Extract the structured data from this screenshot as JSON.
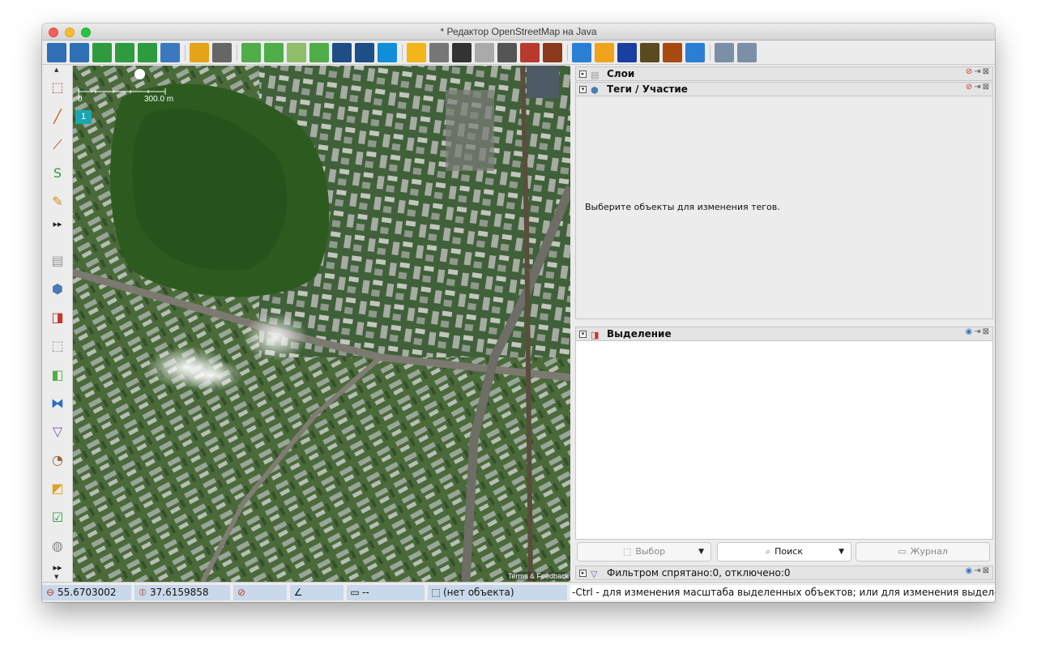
{
  "window": {
    "title": "* Редактор OpenStreetMap на Java"
  },
  "toolbar": {
    "buttons": [
      {
        "name": "open-file-icon",
        "color": "#2f6fb5"
      },
      {
        "name": "open-location-icon",
        "color": "#2f6fb5"
      },
      {
        "name": "download-icon",
        "color": "#2e9b3e"
      },
      {
        "name": "download-along-icon",
        "color": "#2e9b3e"
      },
      {
        "name": "upload-icon",
        "color": "#2e9b3e"
      },
      {
        "name": "preferences-globe-icon",
        "color": "#3a78c0"
      },
      {
        "name": "undo-icon",
        "color": "#e5a417"
      },
      {
        "name": "redo-icon",
        "color": "#666666"
      },
      {
        "name": "zoom-to-data-icon",
        "color": "#4fae4a"
      },
      {
        "name": "print-icon",
        "color": "#4fae4a"
      },
      {
        "name": "wms-tms-icon",
        "color": "#8fbe6a"
      },
      {
        "name": "search-zoom-icon",
        "color": "#4fae4a"
      },
      {
        "name": "preset-road-icon",
        "color": "#1d4e86"
      },
      {
        "name": "preset-road-alt-icon",
        "color": "#1d4e86"
      },
      {
        "name": "bing-imagery-icon",
        "color": "#108ed8"
      },
      {
        "name": "highway-yellow-icon",
        "color": "#f2b51a"
      },
      {
        "name": "highway-grey-icon",
        "color": "#777777"
      },
      {
        "name": "highway-dark-icon",
        "color": "#333333"
      },
      {
        "name": "highway-light-icon",
        "color": "#aaaaaa"
      },
      {
        "name": "traffic-signals-icon",
        "color": "#555555"
      },
      {
        "name": "building-brick-icon",
        "color": "#b83a2e"
      },
      {
        "name": "railway-icon",
        "color": "#8a3a1a"
      },
      {
        "name": "accommodation-bed-icon",
        "color": "#2a7fd4"
      },
      {
        "name": "shop-bag-icon",
        "color": "#f0a21a"
      },
      {
        "name": "information-icon",
        "color": "#1a3fa0"
      },
      {
        "name": "industrial-icon",
        "color": "#5a4a20"
      },
      {
        "name": "peak-icon",
        "color": "#a84a10"
      },
      {
        "name": "waterway-icon",
        "color": "#2a7fd4"
      },
      {
        "name": "zoom-in-icon",
        "color": "#7b8fa8"
      },
      {
        "name": "zoom-out-icon",
        "color": "#7b8fa8"
      }
    ]
  },
  "left_tools": [
    {
      "name": "select-tool-icon",
      "glyph": "⬚",
      "color": "#c0392b"
    },
    {
      "name": "draw-line-tool-icon",
      "glyph": "╱",
      "color": "#d35400"
    },
    {
      "name": "improve-way-tool-icon",
      "glyph": "⟋",
      "color": "#c0392b"
    },
    {
      "name": "parallel-way-tool-icon",
      "glyph": "S",
      "color": "#2e9b3e"
    },
    {
      "name": "pencil-tool-icon",
      "glyph": "✎",
      "color": "#d68910"
    },
    {
      "name": "more-tools-1-icon",
      "glyph": "▸▸",
      "color": "#222222"
    },
    {
      "name": "layers-toggle-icon",
      "glyph": "▤",
      "color": "#999999"
    },
    {
      "name": "tags-toggle-icon",
      "glyph": "⬢",
      "color": "#4a7bb5"
    },
    {
      "name": "selection-toggle-icon",
      "glyph": "◨",
      "color": "#c0392b"
    },
    {
      "name": "relation-toggle-icon",
      "glyph": "⬚",
      "color": "#888888"
    },
    {
      "name": "commands-toggle-icon",
      "glyph": "◧",
      "color": "#4fae4a"
    },
    {
      "name": "conflict-toggle-icon",
      "glyph": "⧓",
      "color": "#2a6fc4"
    },
    {
      "name": "filter-toggle-icon",
      "glyph": "▽",
      "color": "#7a5ab0"
    },
    {
      "name": "mapstyle-toggle-icon",
      "glyph": "◔",
      "color": "#a06030"
    },
    {
      "name": "validation-toggle-icon",
      "glyph": "◩",
      "color": "#e0a020"
    },
    {
      "name": "todo-toggle-icon",
      "glyph": "☑",
      "color": "#2e9b3e"
    },
    {
      "name": "wikipedia-toggle-icon",
      "glyph": "◍",
      "color": "#888888"
    },
    {
      "name": "more-tools-2-icon",
      "glyph": "▸▸",
      "color": "#222222"
    }
  ],
  "map": {
    "scale_zero": "0",
    "scale_max": "300.0 m",
    "layer_badge": "1",
    "attribution": "Terms & Feedback"
  },
  "panels": {
    "layers": {
      "title": "Слои"
    },
    "tags": {
      "title": "Теги / Участие",
      "hint": "Выберите объекты для изменения тегов."
    },
    "selection": {
      "title": "Выделение"
    },
    "buttons": {
      "select": "Выбор",
      "search": "Поиск",
      "history": "Журнал"
    },
    "filter": {
      "title": "Фильтром спрятано:0, отключено:0"
    }
  },
  "statusbar": {
    "lat": "55.6703002",
    "lon": "37.6159858",
    "heading": "",
    "angle": "",
    "distance": "--",
    "object": "(нет объекта)",
    "help": "-Ctrl - для изменения масштаба выделенных объектов; или для изменения выделения"
  }
}
